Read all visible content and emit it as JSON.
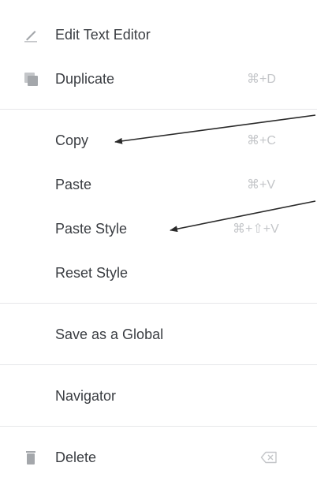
{
  "context_menu": {
    "edit": {
      "label": "Edit Text Editor",
      "icon": "pencil-icon"
    },
    "duplicate": {
      "label": "Duplicate",
      "shortcut": "⌘+D",
      "icon": "duplicate-icon"
    },
    "copy": {
      "label": "Copy",
      "shortcut": "⌘+C"
    },
    "paste": {
      "label": "Paste",
      "shortcut": "⌘+V"
    },
    "paste_style": {
      "label": "Paste Style",
      "shortcut": "⌘+⇧+V"
    },
    "reset_style": {
      "label": "Reset Style"
    },
    "save_global": {
      "label": "Save as a Global"
    },
    "navigator": {
      "label": "Navigator"
    },
    "delete": {
      "label": "Delete",
      "icon": "trash-icon",
      "shortcut_icon": "delete-key-icon"
    }
  },
  "colors": {
    "text": "#3a3d42",
    "shortcut": "#c4c6c9",
    "divider": "#e6e7e9",
    "icon": "#a4a7ab",
    "annotation_arrow": "#2a2a2a"
  }
}
